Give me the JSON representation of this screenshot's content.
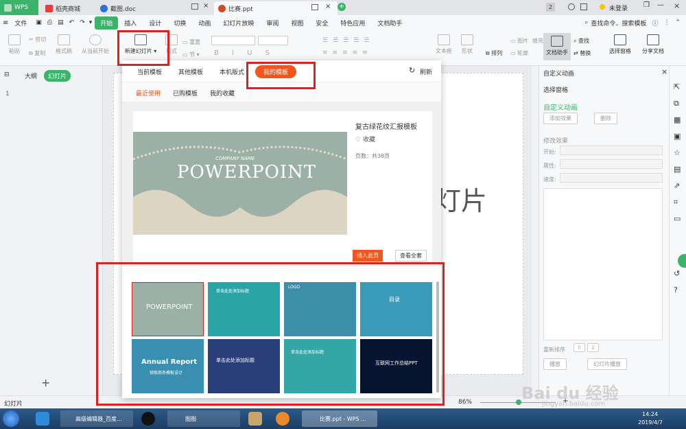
{
  "titlebar": {
    "tabs": [
      {
        "label": "WPS"
      },
      {
        "label": "稻壳商城"
      },
      {
        "label": "截图.doc"
      },
      {
        "label": "比赛.ppt"
      }
    ],
    "badge": "2",
    "user": "未登录"
  },
  "menu": {
    "file": "文件",
    "items": [
      "开始",
      "插入",
      "设计",
      "切换",
      "动画",
      "幻灯片放映",
      "审阅",
      "视图",
      "安全",
      "特色应用",
      "文档助手"
    ],
    "search": "查找命令、搜索模板"
  },
  "ribbon": {
    "paste": "粘贴",
    "cut": "剪切",
    "copy": "复制",
    "format_painter": "格式刷",
    "from_current": "从当前开始",
    "new_slide": "新建幻灯片",
    "layout": "版式",
    "section": "节",
    "reset": "重置",
    "textbox": "文本框",
    "shape": "形状",
    "arrange": "排列",
    "picture": "图片",
    "fill": "填充",
    "outline": "轮廓",
    "doc_helper": "文档助手",
    "find": "查找",
    "replace": "替换",
    "select_pane": "选择窗格",
    "share_doc": "分享文档"
  },
  "left": {
    "outline": "大纲",
    "slides": "幻灯片",
    "slide_num": "1"
  },
  "slide": {
    "placeholder_text": "灯片"
  },
  "dialog": {
    "tabs": [
      "当前模板",
      "其他模板",
      "本机版式",
      "我的模板"
    ],
    "refresh": "刷新",
    "subtabs": [
      "最近使用",
      "已购模板",
      "我的收藏"
    ],
    "preview": {
      "company": "COMPANY NAME",
      "title": "POWERPOINT"
    },
    "template_name": "复古绿花纹汇报模板",
    "favorite": "收藏",
    "pages": "页数：共38页",
    "insert_page": "插入此页",
    "view_all": "查看全套",
    "thumbs": [
      {
        "text": "POWERPOINT",
        "bg": "#9bb0a6"
      },
      {
        "text": "单击此处添加标题",
        "bg": "#2aa5a5"
      },
      {
        "text": "LOGO",
        "bg": "#3d8ea8"
      },
      {
        "text": "目录",
        "bg": "#3a9ab7"
      },
      {
        "text": "Annual Report",
        "sub": "锐取商务模板设计",
        "bg": "#3a8fb0"
      },
      {
        "text": "单击此处添加标题",
        "bg": "#2a3f7a"
      },
      {
        "text": "单击此处添加标题",
        "bg": "#34a6a6"
      },
      {
        "text": "互联网工作总结PPT",
        "bg": "#071430"
      }
    ]
  },
  "right": {
    "title": "自定义动画",
    "select_pane": "选择窗格",
    "custom_anim": "自定义动画",
    "add_effect": "添加效果",
    "delete": "删除",
    "modify": "修改效果",
    "start": "开始:",
    "property": "属性:",
    "speed": "速度:",
    "reorder": "重新排序",
    "play": "播放",
    "slideshow": "幻灯片播放"
  },
  "status": {
    "slide": "幻灯片",
    "zoom": "86%",
    "watermark_a": "Bai du 经验",
    "watermark_b": "jingyan.baidu.com"
  },
  "taskbar": {
    "items": [
      "高级编辑器_百度...",
      "图图",
      "比赛.ppt - WPS ..."
    ],
    "time": "14:24",
    "date": "2019/4/7"
  },
  "colors": {
    "accent": "#3bb36b",
    "red": "#e02020",
    "orange": "#f2561d"
  }
}
